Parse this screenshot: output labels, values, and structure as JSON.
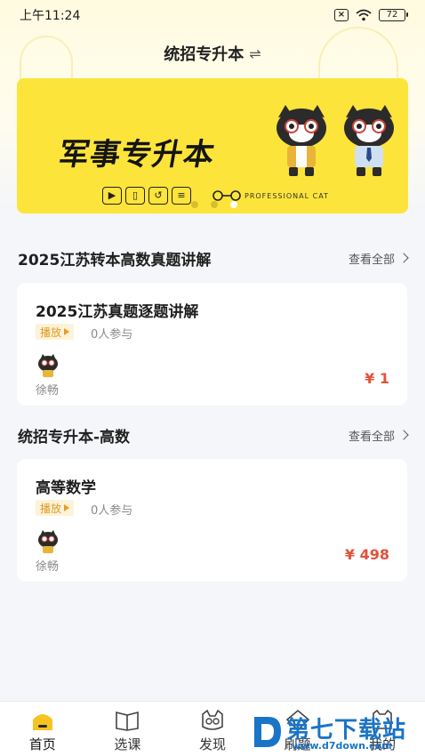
{
  "status_bar": {
    "time": "上午11:24",
    "battery": "72"
  },
  "header": {
    "title": "统招专升本",
    "switch_icon": "⇌"
  },
  "banner": {
    "title": "军事专升本",
    "caption": "PROFESSIONAL CAT",
    "slides": 3,
    "active_slide": 1
  },
  "sections": [
    {
      "title": "2025江苏转本高数真题讲解",
      "view_all": "查看全部",
      "card": {
        "title": "2025江苏真题逐题讲解",
        "tag": "播放",
        "participants": "0人参与",
        "teacher": "徐畅",
        "price": "¥ 1"
      }
    },
    {
      "title": "统招专升本-高数",
      "view_all": "查看全部",
      "card": {
        "title": "高等数学",
        "tag": "播放",
        "participants": "0人参与",
        "teacher": "徐畅",
        "price": "¥ 498"
      }
    }
  ],
  "bottom_nav": [
    {
      "label": "首页",
      "icon": "home-icon",
      "active": true
    },
    {
      "label": "选课",
      "icon": "book-icon",
      "active": false
    },
    {
      "label": "发现",
      "icon": "cat-face-icon",
      "active": false
    },
    {
      "label": "刷题",
      "icon": "practice-icon",
      "active": false
    },
    {
      "label": "我的",
      "icon": "profile-icon",
      "active": false
    }
  ],
  "watermark": {
    "text": "第七下载站",
    "url": "www.d7down.com"
  },
  "colors": {
    "brand_yellow": "#fde43a",
    "price_red": "#e2523a",
    "tag_orange": "#e09a24"
  }
}
